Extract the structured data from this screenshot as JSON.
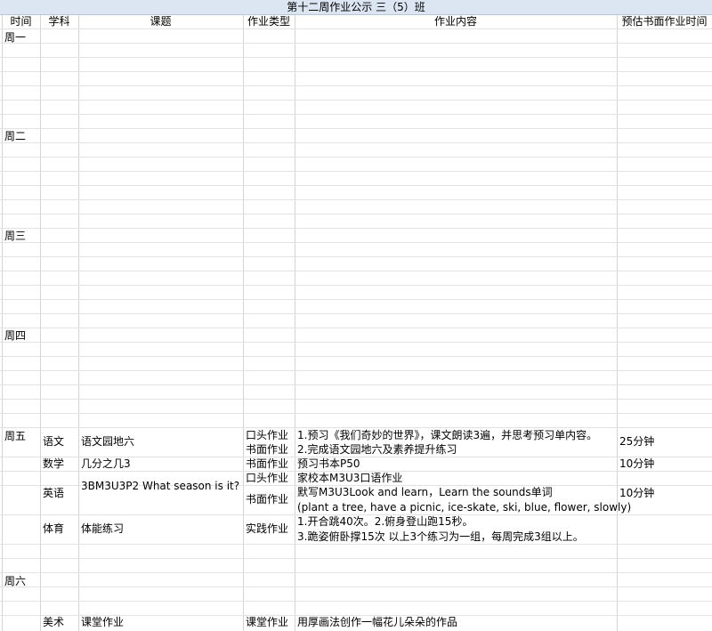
{
  "sheet": {
    "title": "第十二周作业公示 三（5）班",
    "headers": {
      "time": "时间",
      "subject": "学科",
      "topic": "课题",
      "type": "作业类型",
      "content": "作业内容",
      "est": "预估书面作业时间"
    },
    "days": [
      "周一",
      "周二",
      "周三",
      "周四",
      "周五",
      "周六"
    ],
    "friday": {
      "chinese": {
        "subject": "语文",
        "topic": "语文园地六",
        "type1": "口头作业",
        "content1": "1.预习《我们奇妙的世界》，课文朗读3遍，并思考预习单内容。",
        "type2": "书面作业",
        "content2": "2.完成语文园地六及素养提升练习",
        "time": "25分钟"
      },
      "math": {
        "subject": "数学",
        "topic": "几分之几3",
        "type": "书面作业",
        "content": "预习书本P50",
        "time": "10分钟"
      },
      "english": {
        "subject": "英语",
        "topic": "3BM3U3P2 What season is it?",
        "type1": "口头作业",
        "content1": "家校本M3U3口语作业",
        "type2": "书面作业",
        "content2": "默写M3U3Look and learn，Learn the sounds单词",
        "content3": "(plant a tree, have a picnic, ice-skate, ski, blue, flower, slowly)",
        "time": "10分钟"
      },
      "pe": {
        "subject": "体育",
        "topic": "体能练习",
        "type": "实践作业",
        "content1": "1.开合跳40次。2.俯身登山跑15秒。",
        "content2": "3.跪姿俯卧撑15次 以上3个练习为一组，每周完成3组以上。"
      }
    },
    "art": {
      "subject": "美术",
      "topic": "课堂作业",
      "type": "课堂作业",
      "content": "用厚画法创作一幅花儿朵朵的作品"
    }
  }
}
